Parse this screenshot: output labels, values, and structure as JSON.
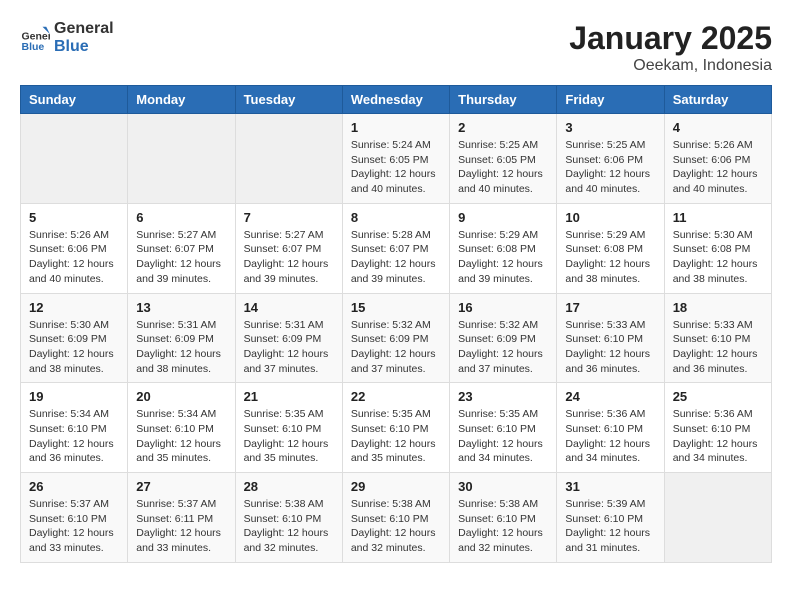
{
  "header": {
    "logo": {
      "general": "General",
      "blue": "Blue"
    },
    "title": "January 2025",
    "subtitle": "Oeekam, Indonesia"
  },
  "weekdays": [
    "Sunday",
    "Monday",
    "Tuesday",
    "Wednesday",
    "Thursday",
    "Friday",
    "Saturday"
  ],
  "weeks": [
    [
      {
        "day": "",
        "sunrise": "",
        "sunset": "",
        "daylight": ""
      },
      {
        "day": "",
        "sunrise": "",
        "sunset": "",
        "daylight": ""
      },
      {
        "day": "",
        "sunrise": "",
        "sunset": "",
        "daylight": ""
      },
      {
        "day": "1",
        "sunrise": "Sunrise: 5:24 AM",
        "sunset": "Sunset: 6:05 PM",
        "daylight": "Daylight: 12 hours and 40 minutes."
      },
      {
        "day": "2",
        "sunrise": "Sunrise: 5:25 AM",
        "sunset": "Sunset: 6:05 PM",
        "daylight": "Daylight: 12 hours and 40 minutes."
      },
      {
        "day": "3",
        "sunrise": "Sunrise: 5:25 AM",
        "sunset": "Sunset: 6:06 PM",
        "daylight": "Daylight: 12 hours and 40 minutes."
      },
      {
        "day": "4",
        "sunrise": "Sunrise: 5:26 AM",
        "sunset": "Sunset: 6:06 PM",
        "daylight": "Daylight: 12 hours and 40 minutes."
      }
    ],
    [
      {
        "day": "5",
        "sunrise": "Sunrise: 5:26 AM",
        "sunset": "Sunset: 6:06 PM",
        "daylight": "Daylight: 12 hours and 40 minutes."
      },
      {
        "day": "6",
        "sunrise": "Sunrise: 5:27 AM",
        "sunset": "Sunset: 6:07 PM",
        "daylight": "Daylight: 12 hours and 39 minutes."
      },
      {
        "day": "7",
        "sunrise": "Sunrise: 5:27 AM",
        "sunset": "Sunset: 6:07 PM",
        "daylight": "Daylight: 12 hours and 39 minutes."
      },
      {
        "day": "8",
        "sunrise": "Sunrise: 5:28 AM",
        "sunset": "Sunset: 6:07 PM",
        "daylight": "Daylight: 12 hours and 39 minutes."
      },
      {
        "day": "9",
        "sunrise": "Sunrise: 5:29 AM",
        "sunset": "Sunset: 6:08 PM",
        "daylight": "Daylight: 12 hours and 39 minutes."
      },
      {
        "day": "10",
        "sunrise": "Sunrise: 5:29 AM",
        "sunset": "Sunset: 6:08 PM",
        "daylight": "Daylight: 12 hours and 38 minutes."
      },
      {
        "day": "11",
        "sunrise": "Sunrise: 5:30 AM",
        "sunset": "Sunset: 6:08 PM",
        "daylight": "Daylight: 12 hours and 38 minutes."
      }
    ],
    [
      {
        "day": "12",
        "sunrise": "Sunrise: 5:30 AM",
        "sunset": "Sunset: 6:09 PM",
        "daylight": "Daylight: 12 hours and 38 minutes."
      },
      {
        "day": "13",
        "sunrise": "Sunrise: 5:31 AM",
        "sunset": "Sunset: 6:09 PM",
        "daylight": "Daylight: 12 hours and 38 minutes."
      },
      {
        "day": "14",
        "sunrise": "Sunrise: 5:31 AM",
        "sunset": "Sunset: 6:09 PM",
        "daylight": "Daylight: 12 hours and 37 minutes."
      },
      {
        "day": "15",
        "sunrise": "Sunrise: 5:32 AM",
        "sunset": "Sunset: 6:09 PM",
        "daylight": "Daylight: 12 hours and 37 minutes."
      },
      {
        "day": "16",
        "sunrise": "Sunrise: 5:32 AM",
        "sunset": "Sunset: 6:09 PM",
        "daylight": "Daylight: 12 hours and 37 minutes."
      },
      {
        "day": "17",
        "sunrise": "Sunrise: 5:33 AM",
        "sunset": "Sunset: 6:10 PM",
        "daylight": "Daylight: 12 hours and 36 minutes."
      },
      {
        "day": "18",
        "sunrise": "Sunrise: 5:33 AM",
        "sunset": "Sunset: 6:10 PM",
        "daylight": "Daylight: 12 hours and 36 minutes."
      }
    ],
    [
      {
        "day": "19",
        "sunrise": "Sunrise: 5:34 AM",
        "sunset": "Sunset: 6:10 PM",
        "daylight": "Daylight: 12 hours and 36 minutes."
      },
      {
        "day": "20",
        "sunrise": "Sunrise: 5:34 AM",
        "sunset": "Sunset: 6:10 PM",
        "daylight": "Daylight: 12 hours and 35 minutes."
      },
      {
        "day": "21",
        "sunrise": "Sunrise: 5:35 AM",
        "sunset": "Sunset: 6:10 PM",
        "daylight": "Daylight: 12 hours and 35 minutes."
      },
      {
        "day": "22",
        "sunrise": "Sunrise: 5:35 AM",
        "sunset": "Sunset: 6:10 PM",
        "daylight": "Daylight: 12 hours and 35 minutes."
      },
      {
        "day": "23",
        "sunrise": "Sunrise: 5:35 AM",
        "sunset": "Sunset: 6:10 PM",
        "daylight": "Daylight: 12 hours and 34 minutes."
      },
      {
        "day": "24",
        "sunrise": "Sunrise: 5:36 AM",
        "sunset": "Sunset: 6:10 PM",
        "daylight": "Daylight: 12 hours and 34 minutes."
      },
      {
        "day": "25",
        "sunrise": "Sunrise: 5:36 AM",
        "sunset": "Sunset: 6:10 PM",
        "daylight": "Daylight: 12 hours and 34 minutes."
      }
    ],
    [
      {
        "day": "26",
        "sunrise": "Sunrise: 5:37 AM",
        "sunset": "Sunset: 6:10 PM",
        "daylight": "Daylight: 12 hours and 33 minutes."
      },
      {
        "day": "27",
        "sunrise": "Sunrise: 5:37 AM",
        "sunset": "Sunset: 6:11 PM",
        "daylight": "Daylight: 12 hours and 33 minutes."
      },
      {
        "day": "28",
        "sunrise": "Sunrise: 5:38 AM",
        "sunset": "Sunset: 6:10 PM",
        "daylight": "Daylight: 12 hours and 32 minutes."
      },
      {
        "day": "29",
        "sunrise": "Sunrise: 5:38 AM",
        "sunset": "Sunset: 6:10 PM",
        "daylight": "Daylight: 12 hours and 32 minutes."
      },
      {
        "day": "30",
        "sunrise": "Sunrise: 5:38 AM",
        "sunset": "Sunset: 6:10 PM",
        "daylight": "Daylight: 12 hours and 32 minutes."
      },
      {
        "day": "31",
        "sunrise": "Sunrise: 5:39 AM",
        "sunset": "Sunset: 6:10 PM",
        "daylight": "Daylight: 12 hours and 31 minutes."
      },
      {
        "day": "",
        "sunrise": "",
        "sunset": "",
        "daylight": ""
      }
    ]
  ]
}
